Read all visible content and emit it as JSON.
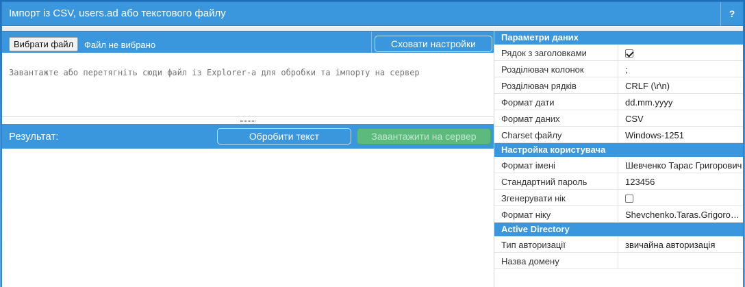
{
  "window": {
    "title": "Імпорт із CSV, users.ad або текстового файлу",
    "help_label": "?"
  },
  "file": {
    "choose_label": "Вибрати файл",
    "status": "Файл не вибрано",
    "hide_settings_label": "Сховати настройки"
  },
  "input": {
    "placeholder": "Завантажте або перетягніть сюди файл із Explorer-а для обробки та імпорту на сервер"
  },
  "result": {
    "label": "Результат:",
    "process_label": "Обробити текст",
    "upload_label": "Завантажити на сервер"
  },
  "settings": {
    "data_params": {
      "title": "Параметри даних",
      "rows": [
        {
          "label": "Рядок з заголовками",
          "checked": true
        },
        {
          "label": "Розділювач колонок",
          "value": ";"
        },
        {
          "label": "Розділювач рядків",
          "value": "CRLF (\\r\\n)"
        },
        {
          "label": "Формат дати",
          "value": "dd.mm.yyyy"
        },
        {
          "label": "Формат даних",
          "value": "CSV"
        },
        {
          "label": "Charset файлу",
          "value": "Windows-1251"
        }
      ]
    },
    "user_settings": {
      "title": "Настройка користувача",
      "rows": [
        {
          "label": "Формат імені",
          "value": "Шевченко Тарас Григорович"
        },
        {
          "label": "Стандартний пароль",
          "value": "123456"
        },
        {
          "label": "Згенерувати нік",
          "checked": false
        },
        {
          "label": "Формат ніку",
          "value": "Shevchenko.Taras.Grigorovich"
        }
      ]
    },
    "active_directory": {
      "title": "Active Directory",
      "rows": [
        {
          "label": "Тип авторизації",
          "value": "звичайна авторизація"
        },
        {
          "label": "Назва домену",
          "value": ""
        }
      ]
    }
  }
}
